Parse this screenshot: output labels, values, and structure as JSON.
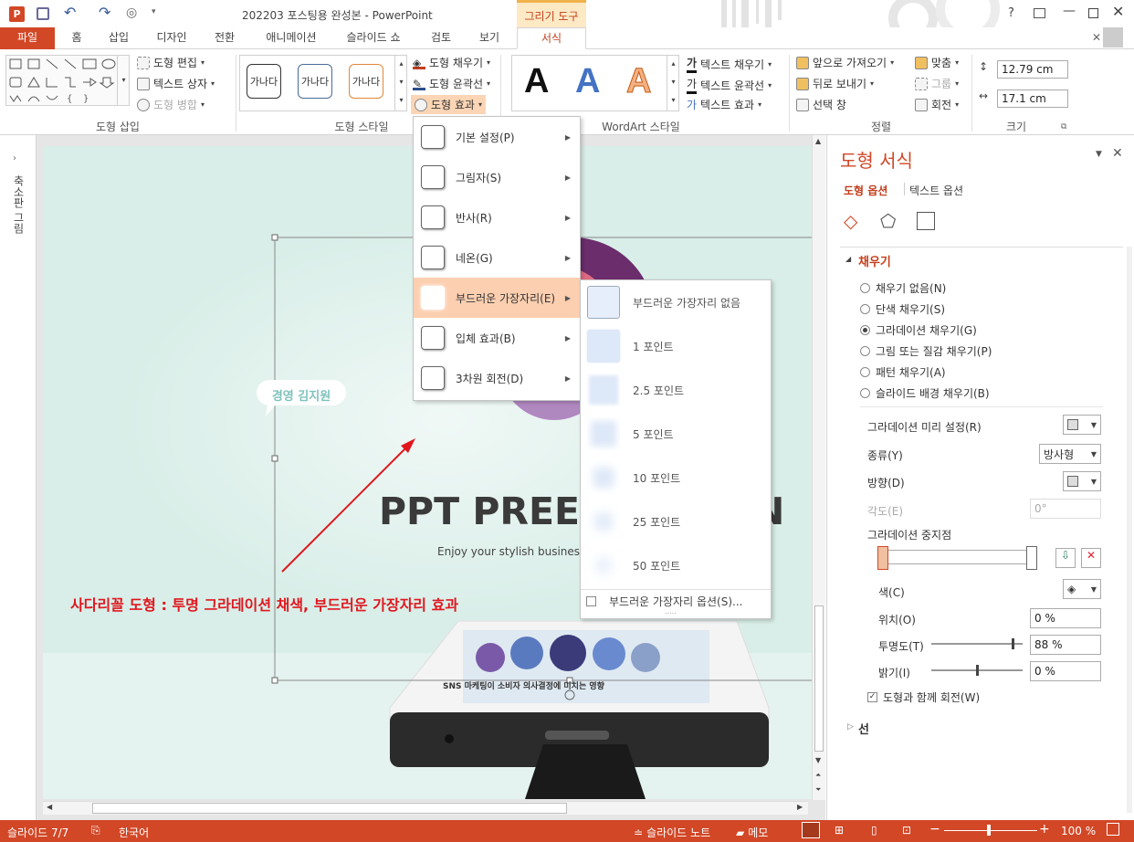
{
  "titlebar": {
    "title": "202203 포스팅용 완성본 - PowerPoint",
    "context_tab": "그리기 도구",
    "help": "?"
  },
  "tabs": [
    "파일",
    "홈",
    "삽입",
    "디자인",
    "전환",
    "애니메이션",
    "슬라이드 쇼",
    "검토",
    "보기",
    "서식"
  ],
  "ribbon": {
    "insert_shapes": {
      "edit_shape": "도형 편집",
      "text_box": "텍스트 상자",
      "merge": "도형 병합",
      "label": "도형 삽입"
    },
    "shape_styles": {
      "sample": "가나다",
      "fill": "도형 채우기",
      "outline": "도형 윤곽선",
      "effects": "도형 효과",
      "label": "도형 스타일"
    },
    "wordart": {
      "letter": "A",
      "text_fill": "텍스트 채우기",
      "text_outline": "텍스트 윤곽선",
      "text_effects": "텍스트 효과",
      "label": "WordArt 스타일"
    },
    "arrange": {
      "bring_forward": "앞으로 가져오기",
      "send_backward": "뒤로 보내기",
      "selection_pane": "선택 창",
      "align": "맞춤",
      "group": "그룹",
      "rotate": "회전",
      "label": "정렬"
    },
    "size": {
      "height": "12.79 cm",
      "width": "17.1 cm",
      "label": "크기"
    }
  },
  "left_strip": {
    "label": "축소판 그림"
  },
  "slide": {
    "speaker": "경영 김지원",
    "title": "PPT PREES",
    "title_tail": "N",
    "subtitle": "Enjoy your stylish business a",
    "annotation": "사다리꼴 도형 : 투명 그라데이션 채색, 부드러운 가장자리 효과",
    "phone_caption": "SNS 마케팅이 소비자 의사결정에 미치는 영향"
  },
  "effects_menu": [
    {
      "label": "기본 설정(P)"
    },
    {
      "label": "그림자(S)"
    },
    {
      "label": "반사(R)"
    },
    {
      "label": "네온(G)"
    },
    {
      "label": "부드러운 가장자리(E)"
    },
    {
      "label": "입체 효과(B)"
    },
    {
      "label": "3차원 회전(D)"
    }
  ],
  "soft_edge_menu": {
    "items": [
      "부드러운 가장자리 없음",
      "1 포인트",
      "2.5 포인트",
      "5 포인트",
      "10 포인트",
      "25 포인트",
      "50 포인트"
    ],
    "options": "부드러운 가장자리 옵션(S)...",
    "grip": "....."
  },
  "pane": {
    "title": "도형 서식",
    "tab_shape": "도형 옵션",
    "tab_text": "텍스트 옵션",
    "fill_header": "채우기",
    "fill_options": [
      "채우기 없음(N)",
      "단색 채우기(S)",
      "그라데이션 채우기(G)",
      "그림 또는 질감 채우기(P)",
      "패턴 채우기(A)",
      "슬라이드 배경 채우기(B)"
    ],
    "selected_fill": 2,
    "preset_label": "그라데이션 미리 설정(R)",
    "type_label": "종류(Y)",
    "type_value": "방사형",
    "direction_label": "방향(D)",
    "angle_label": "각도(E)",
    "angle_value": "0°",
    "stops_label": "그라데이션 중지점",
    "color_label": "색(C)",
    "position_label": "위치(O)",
    "position_value": "0 %",
    "transparency_label": "투명도(T)",
    "transparency_value": "88 %",
    "brightness_label": "밝기(I)",
    "brightness_value": "0 %",
    "rotate_with_shape": "도형과 함께 회전(W)",
    "line_header": "선"
  },
  "status": {
    "slide": "슬라이드 7/7",
    "lang": "한국어",
    "notes": "슬라이드 노트",
    "comments": "메모",
    "zoom": "100 %"
  },
  "colors": {
    "accent": "#d24726",
    "slide_bg": "#d9eee8",
    "annotation": "#e0171f"
  }
}
